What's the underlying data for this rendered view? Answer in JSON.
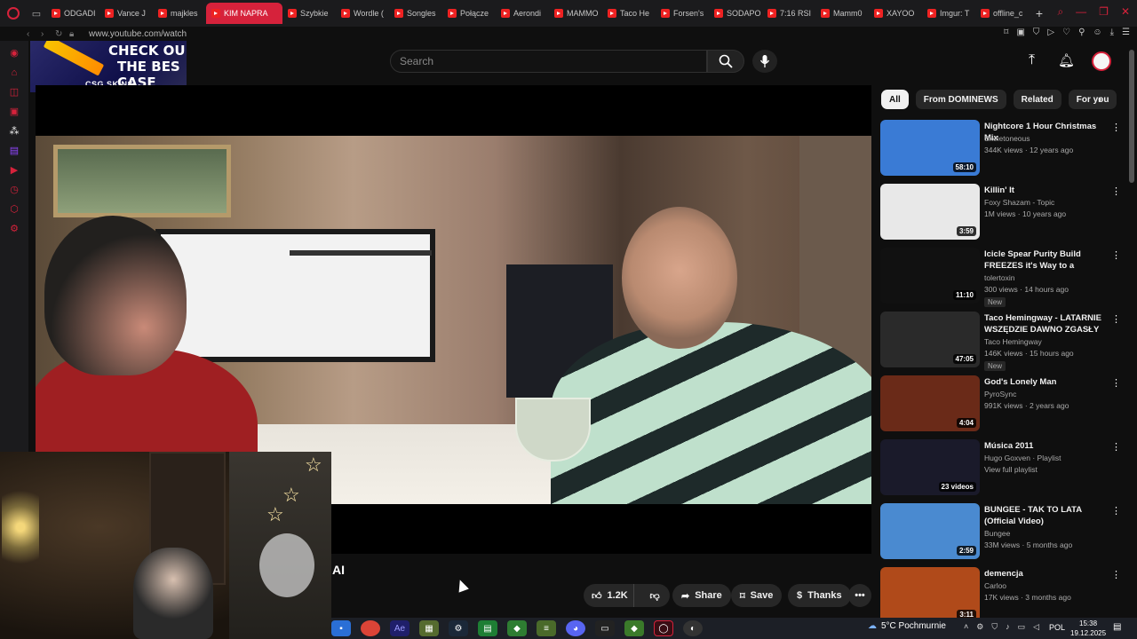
{
  "browser": {
    "tabs": [
      {
        "label": "ODGADI"
      },
      {
        "label": "Vance J"
      },
      {
        "label": "majkles"
      },
      {
        "label": "KIM NAPRA"
      },
      {
        "label": "Szybkie"
      },
      {
        "label": "Wordle ("
      },
      {
        "label": "Songles"
      },
      {
        "label": "Połącze"
      },
      {
        "label": "Aerondi"
      },
      {
        "label": "MAMMO"
      },
      {
        "label": "Taco He"
      },
      {
        "label": "Forsen's"
      },
      {
        "label": "SODAPO"
      },
      {
        "label": "7:16 RSI"
      },
      {
        "label": "Mamm0"
      },
      {
        "label": "XAYOO"
      },
      {
        "label": "Imgur: T"
      },
      {
        "label": "offline_c"
      }
    ],
    "url": "www.youtube.com/watch"
  },
  "ad": {
    "line1": "CHECK OU",
    "line2": "THE BES",
    "line3": "CASE",
    "brand": "CSG SKINS"
  },
  "header": {
    "search_placeholder": "Search"
  },
  "video": {
    "title_fragment": "AI"
  },
  "actions": {
    "like_count": "1.2K",
    "share_label": "Share",
    "save_label": "Save",
    "thanks_label": "Thanks"
  },
  "chips": [
    "All",
    "From DOMINEWS",
    "Related",
    "For you"
  ],
  "recommendations": [
    {
      "title": "Nightcore 1 Hour Christmas Mix",
      "channel": "Skeletoneous",
      "meta": "344K views · 12 years ago",
      "duration": "58:10",
      "badge": "",
      "thumb_color": "#3a7bd5"
    },
    {
      "title": "Killin' It",
      "channel": "Foxy Shazam - Topic",
      "meta": "1M views · 10 years ago",
      "duration": "3:59",
      "badge": "",
      "thumb_color": "#e8e8e8"
    },
    {
      "title": "Icicle Spear Purity Build FREEZES it's Way to a Champi...",
      "channel": "tolertoxin",
      "meta": "300 views · 14 hours ago",
      "duration": "11:10",
      "badge": "New",
      "thumb_color": "#111111"
    },
    {
      "title": "Taco Hemingway - LATARNIE WSZĘDZIE DAWNO ZGASŁY ...",
      "channel": "Taco Hemingway",
      "meta": "146K views · 15 hours ago",
      "duration": "47:05",
      "badge": "New",
      "thumb_color": "#2a2a2a"
    },
    {
      "title": "God's Lonely Man",
      "channel": "PyroSync",
      "meta": "991K views · 2 years ago",
      "duration": "4:04",
      "badge": "",
      "thumb_color": "#6a2a18"
    },
    {
      "title": "Música 2011",
      "channel": "Hugo Goxven · Playlist",
      "meta": "View full playlist",
      "duration": "23 videos",
      "badge": "",
      "thumb_color": "#1a1a2a"
    },
    {
      "title": "BUNGEE - TAK TO LATA (Official Video)",
      "channel": "Bungee",
      "meta": "33M views · 5 months ago",
      "duration": "2:59",
      "badge": "",
      "thumb_color": "#4a8ad0"
    },
    {
      "title": "demencja",
      "channel": "Carloo",
      "meta": "17K views · 3 months ago",
      "duration": "3:11",
      "badge": "",
      "thumb_color": "#b04a1a"
    }
  ],
  "taskbar": {
    "weather": "5°C  Pochmurnie",
    "language": "POL",
    "time": "15:38",
    "date": "19.12.2025"
  },
  "colors": {
    "accent": "#d6223b",
    "background": "#0f0f0f",
    "chip_bg": "#272727"
  }
}
